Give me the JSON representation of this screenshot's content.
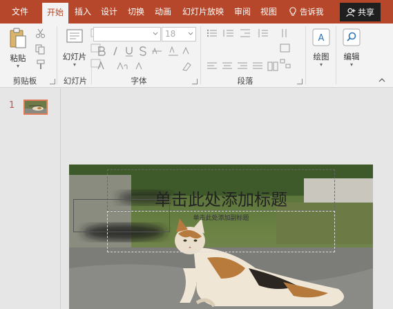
{
  "tabs": [
    "文件",
    "开始",
    "插入",
    "设计",
    "切换",
    "动画",
    "幻灯片放映",
    "审阅",
    "视图"
  ],
  "active_tab": "开始",
  "tell_me": "告诉我",
  "share": "共享",
  "ribbon": {
    "clipboard": {
      "paste": "粘贴",
      "label": "剪贴板"
    },
    "slides": {
      "new_slide": "幻灯片",
      "label": "幻灯片"
    },
    "font": {
      "font_name": "",
      "font_size": "18",
      "label": "字体"
    },
    "paragraph": {
      "label": "段落"
    },
    "drawing": {
      "label": "绘图"
    },
    "editing": {
      "label": "编辑"
    }
  },
  "thumbnails": {
    "slide_number": "1"
  },
  "slide": {
    "title_placeholder": "单击此处添加标题",
    "subtitle_placeholder": "单击此处添加副标题"
  },
  "colors": {
    "accent": "#b7472a",
    "ribbon_bg": "#f3f3f3",
    "workspace_bg": "#e6e6e6",
    "share_bg": "#1f1f1f"
  },
  "icons": [
    "lightbulb-icon",
    "person-add-icon",
    "paste-icon",
    "cut-icon",
    "copy-icon",
    "format-painter-icon",
    "new-slide-icon",
    "layout-icon",
    "reset-icon",
    "section-icon",
    "shapes-icon",
    "find-icon",
    "collapse-ribbon-icon"
  ]
}
